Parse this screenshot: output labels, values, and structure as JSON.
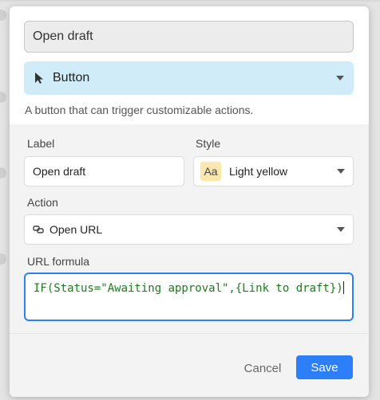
{
  "field": {
    "name_value": "Open draft",
    "type_label": "Button",
    "type_description": "A button that can trigger customizable actions."
  },
  "config": {
    "label_heading": "Label",
    "label_value": "Open draft",
    "style_heading": "Style",
    "style_badge": "Aa",
    "style_value": "Light yellow",
    "action_heading": "Action",
    "action_value": "Open URL",
    "url_formula_heading": "URL formula",
    "url_formula_value": "IF(Status=\"Awaiting approval\",{Link to draft})"
  },
  "footer": {
    "cancel_label": "Cancel",
    "save_label": "Save"
  },
  "colors": {
    "accent": "#2d7ff9",
    "type_select_bg": "#d0ecf8",
    "style_badge_bg": "#fbe7b0",
    "formula_text": "#1e7a1e"
  },
  "icons": {
    "type_icon": "cursor-arrow-icon",
    "action_icon": "link-icon",
    "dropdown": "chevron-down-icon"
  }
}
